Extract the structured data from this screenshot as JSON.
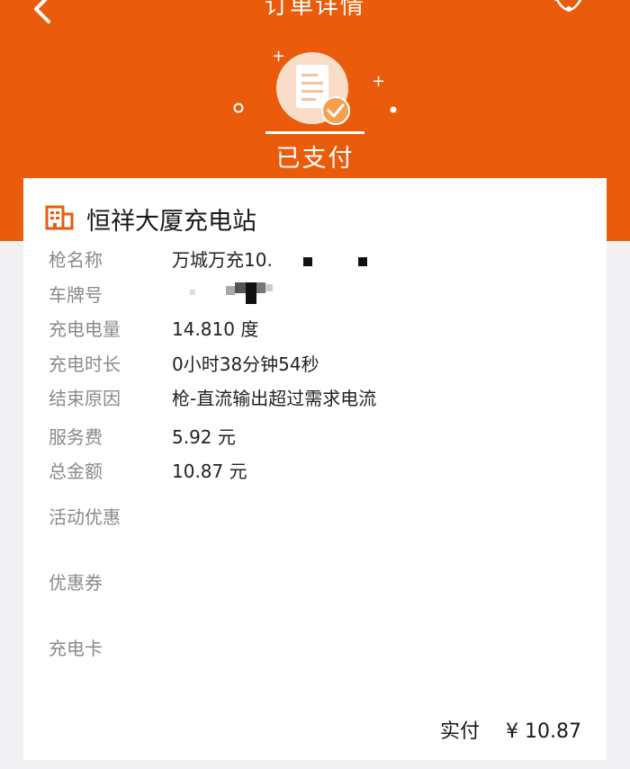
{
  "nav": {
    "title": "订单详情",
    "back_icon": "chevron-left-icon",
    "service_icon": "headset-icon"
  },
  "status": {
    "label": "已支付",
    "icon": "receipt-check-icon"
  },
  "station": {
    "icon": "building-icon",
    "name": "恒祥大厦充电站"
  },
  "details": [
    {
      "label": "枪名称",
      "value": "万城万充10."
    },
    {
      "label": "车牌号",
      "value": ""
    },
    {
      "label": "充电电量",
      "value": "14.810 度"
    },
    {
      "label": "充电时长",
      "value": "0小时38分钟54秒"
    },
    {
      "label": "结束原因",
      "value": "枪-直流输出超过需求电流"
    },
    {
      "label": "服务费",
      "value": "5.92 元"
    },
    {
      "label": "总金额",
      "value": "10.87 元"
    }
  ],
  "discounts": [
    {
      "label": "活动优惠",
      "value": ""
    },
    {
      "label": "优惠券",
      "value": ""
    },
    {
      "label": "充电卡",
      "value": ""
    }
  ],
  "payment": {
    "label": "实付",
    "amount": "¥ 10.87"
  },
  "colors": {
    "brand_orange": "#ea5b0c",
    "label_gray": "#8a8a8a",
    "page_bg": "#f1f1f3"
  }
}
